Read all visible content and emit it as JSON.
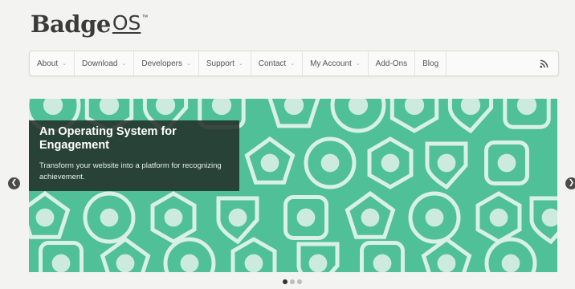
{
  "logo": {
    "badge": "Badge",
    "os": "OS",
    "tm": "™"
  },
  "nav": {
    "items": [
      {
        "label": "About",
        "caret": "⌄"
      },
      {
        "label": "Download",
        "caret": "⌄"
      },
      {
        "label": "Developers",
        "caret": "⌄"
      },
      {
        "label": "Support",
        "caret": "⌄"
      },
      {
        "label": "Contact",
        "caret": "⌄"
      },
      {
        "label": "My Account",
        "caret": "⌄"
      },
      {
        "label": "Add-Ons"
      },
      {
        "label": "Blog"
      }
    ],
    "rss_icon": "rss-icon"
  },
  "slider": {
    "background": "#4fc097",
    "badge_color": "#d9f0e6",
    "caption_title": "An Operating System for Engagement",
    "caption_text": "Transform your website into a platform for recognizing achievement.",
    "prev_glyph": "❮",
    "next_glyph": "❯",
    "active_slide": 1,
    "slide_count": 3
  }
}
